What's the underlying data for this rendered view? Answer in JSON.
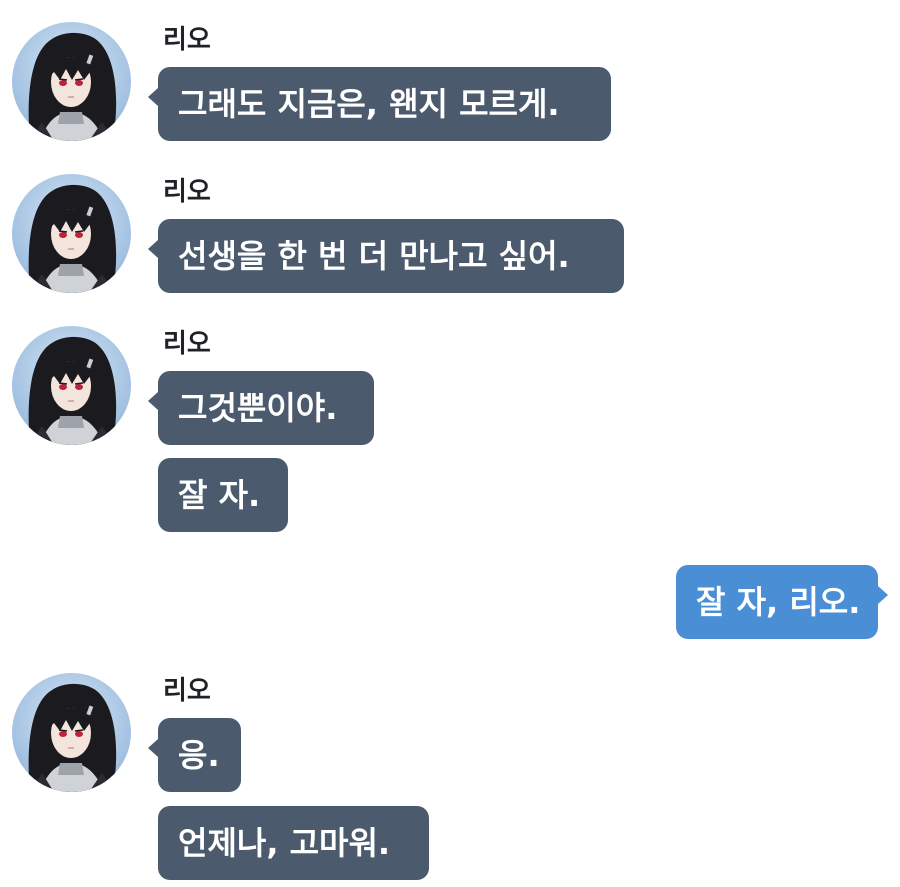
{
  "chat": {
    "contact_name": "리오",
    "groups": [
      {
        "sender": "리오",
        "messages": [
          "그래도 지금은, 왠지 모르게."
        ]
      },
      {
        "sender": "리오",
        "messages": [
          "선생을 한 번 더 만나고 싶어."
        ]
      },
      {
        "sender": "리오",
        "messages": [
          "그것뿐이야.",
          "잘 자."
        ]
      },
      {
        "sender": "me",
        "messages": [
          "잘 자, 리오."
        ]
      },
      {
        "sender": "리오",
        "messages": [
          "응.",
          "언제나, 고마워."
        ]
      }
    ]
  },
  "colors": {
    "incoming_bubble": "#4b5a6d",
    "outgoing_bubble": "#4a8fd6",
    "bubble_text": "#ffffff",
    "name_text": "#1f2226",
    "background": "#ffffff"
  },
  "icons": {
    "avatar": "anime-character-avatar"
  }
}
